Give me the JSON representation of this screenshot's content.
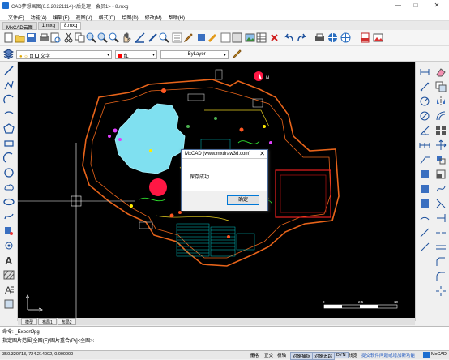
{
  "window": {
    "title": "CAD梦想画图(6.3.20221114)<后处理，会员1>  - 8.mxg",
    "minimize": "—",
    "maximize": "□",
    "close": "✕"
  },
  "menu": [
    "文件(F)",
    "功能(A)",
    "编辑(E)",
    "视图(V)",
    "格式(O)",
    "绘图(D)",
    "修改(M)",
    "帮助(H)"
  ],
  "doc_tabs": [
    {
      "label": "MxCAD云图",
      "active": false
    },
    {
      "label": "1.mxg",
      "active": false
    },
    {
      "label": "8.mxg",
      "active": true
    }
  ],
  "properties": {
    "layer": "文字",
    "color": "红",
    "linetype": "ByLayer",
    "colors": {
      "accent": "#ff0000"
    }
  },
  "north_label": "N",
  "scale_labels": [
    "0",
    "2.5",
    "10"
  ],
  "layout_tabs": [
    "模型",
    "布局1",
    "布局2"
  ],
  "command_lines": [
    "命令: _ExportJpg",
    "指定图片范围[全图(F)/图片重合(P)]<全图>:"
  ],
  "status": {
    "coords": "350.320713,  724.214002,  0.000000",
    "buttons": [
      "栅格",
      "正交",
      "极轴",
      "对象捕捉",
      "对象追踪",
      "DYN",
      "线宽"
    ],
    "active_buttons": [
      "对象捕捉",
      "对象追踪",
      "DYN"
    ],
    "link": "提交软件问题或增加新功能",
    "brand": "MxCAD"
  },
  "dialog": {
    "title": "MxCAD (www.mxdraw3d.com)",
    "close": "✕",
    "message": "保存成功",
    "ok_label": "确定"
  }
}
